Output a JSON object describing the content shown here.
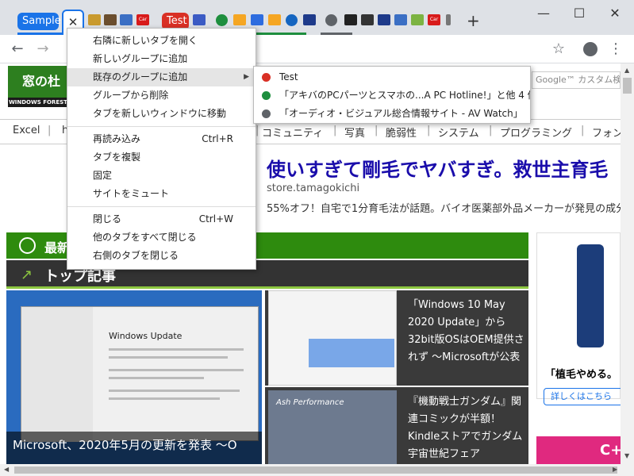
{
  "tabstrip": {
    "groups": [
      {
        "label": "Sample",
        "color": "#1a73e8"
      },
      {
        "label": "Test",
        "color": "#d93025"
      }
    ],
    "close_glyph": "✕",
    "new_tab_glyph": "+",
    "favicons": [
      "tab-favicon",
      "tab-favicon",
      "tab-favicon",
      "tab-favicon",
      "tab-favicon",
      "tab-favicon",
      "tab-favicon",
      "tab-favicon",
      "tab-favicon",
      "tab-favicon",
      "tab-favicon",
      "tab-favicon",
      "tab-favicon",
      "tab-favicon",
      "tab-favicon",
      "tab-favicon",
      "tab-favicon",
      "tab-favicon",
      "tab-favicon",
      "tab-favicon"
    ],
    "favicon_labels": {
      "car1": "Car",
      "car2": "Car"
    },
    "window_controls": {
      "minimize": "—",
      "maximize": "☐",
      "close": "✕"
    }
  },
  "toolbar": {
    "back": "←",
    "forward": "→",
    "address_partial": "G",
    "star": "☆",
    "menu": "⋮"
  },
  "site": {
    "logo_main": "窓の杜",
    "logo_sub": "WINDOWS FOREST",
    "search_placeholder": "Google™ カスタム検索",
    "nav": [
      "Excel",
      "h",
      "コミュニティ",
      "写真",
      "脆弱性",
      "システム",
      "プログラミング",
      "フォン"
    ],
    "ad_title": "使いすぎて剛毛でヤバすぎ。救世主育毛",
    "ad_url": "store.tamagokichi",
    "ad_desc": "55%オフ！自宅で1分育毛法が話題。バイオ医薬部外品メーカーが発見の成分",
    "section_latest": "最新",
    "section_top": "トップ記事",
    "tile1_window_title": "Windows Update",
    "tile1_caption": "Microsoft、2020年5月の更新を発表 〜O",
    "tile2_text": "「Windows 10 May 2020 Update」から32bit版OSはOEM提供されず 〜Microsoftが公表",
    "tile3_img_text": "Ash Performance",
    "tile3_text": "『機動戦士ガンダム』関連コミックが半額！Kindleストアでガンダム宇宙世紀フェア",
    "side_ad_text": "「植毛やめる。",
    "side_ad_button": "詳しくはこちら",
    "pink_ad_text": "C+"
  },
  "context_menu": {
    "items": [
      {
        "label": "右隣に新しいタブを開く",
        "shortcut": ""
      },
      {
        "label": "新しいグループに追加",
        "shortcut": ""
      },
      {
        "label": "既存のグループに追加",
        "shortcut": "",
        "submenu": true,
        "highlighted": true
      },
      {
        "label": "グループから削除",
        "shortcut": ""
      },
      {
        "label": "タブを新しいウィンドウに移動",
        "shortcut": ""
      },
      {
        "label": "再読み込み",
        "shortcut": "Ctrl+R"
      },
      {
        "label": "タブを複製",
        "shortcut": ""
      },
      {
        "label": "固定",
        "shortcut": ""
      },
      {
        "label": "サイトをミュート",
        "shortcut": ""
      },
      {
        "label": "閉じる",
        "shortcut": "Ctrl+W"
      },
      {
        "label": "他のタブをすべて閉じる",
        "shortcut": ""
      },
      {
        "label": "右側のタブを閉じる",
        "shortcut": ""
      }
    ]
  },
  "submenu": {
    "items": [
      {
        "label": "Test",
        "color": "#d93025"
      },
      {
        "label": "「アキバのPCパーツとスマホの...A PC Hotline!」と他 4 個のタブ",
        "color": "#1e8e3e"
      },
      {
        "label": "「オーディオ・ビジュアル総合情報サイト - AV Watch」",
        "color": "#5f6368"
      }
    ]
  },
  "colors": {
    "accent": "#1a73e8",
    "site_green": "#2e8b0e",
    "dark_bar": "#333333"
  }
}
